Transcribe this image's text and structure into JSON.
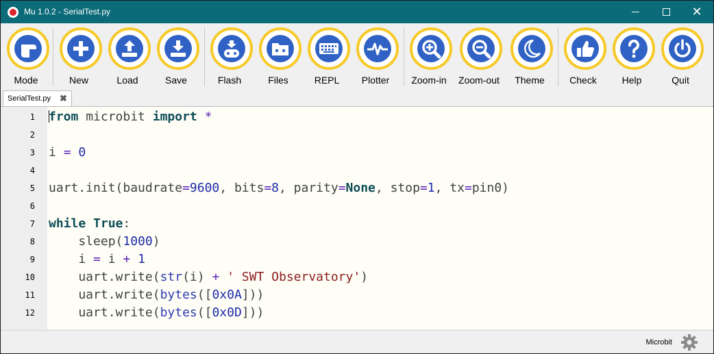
{
  "window": {
    "title": "Mu 1.0.2 - SerialTest.py",
    "minimize_symbol": "",
    "maximize_symbol": "",
    "close_symbol": "✕"
  },
  "toolbar": {
    "buttons": [
      {
        "label": "Mode",
        "icon": "mode-icon"
      },
      {
        "label": "New",
        "icon": "plus-icon"
      },
      {
        "label": "Load",
        "icon": "upload-icon"
      },
      {
        "label": "Save",
        "icon": "download-icon"
      },
      {
        "label": "Flash",
        "icon": "microbit-flash-icon"
      },
      {
        "label": "Files",
        "icon": "microbit-files-icon"
      },
      {
        "label": "REPL",
        "icon": "keyboard-icon"
      },
      {
        "label": "Plotter",
        "icon": "pulse-icon"
      },
      {
        "label": "Zoom-in",
        "icon": "zoom-in-icon"
      },
      {
        "label": "Zoom-out",
        "icon": "zoom-out-icon"
      },
      {
        "label": "Theme",
        "icon": "moon-icon"
      },
      {
        "label": "Check",
        "icon": "thumbs-up-icon"
      },
      {
        "label": "Help",
        "icon": "question-icon"
      },
      {
        "label": "Quit",
        "icon": "power-icon"
      }
    ],
    "ring_color": "#f7c928",
    "icon_color": "#2f62c4"
  },
  "tabs": [
    {
      "label": "SerialTest.py",
      "close": "✖"
    }
  ],
  "editor": {
    "line_numbers": [
      "1",
      "2",
      "3",
      "4",
      "5",
      "6",
      "7",
      "8",
      "9",
      "10",
      "11",
      "12"
    ]
  },
  "status": {
    "mode": "Microbit"
  },
  "colors": {
    "titlebar": "#0c6b78",
    "keyword": "#0d4d56",
    "number": "#1e2aa8",
    "string": "#8a1c1c"
  }
}
